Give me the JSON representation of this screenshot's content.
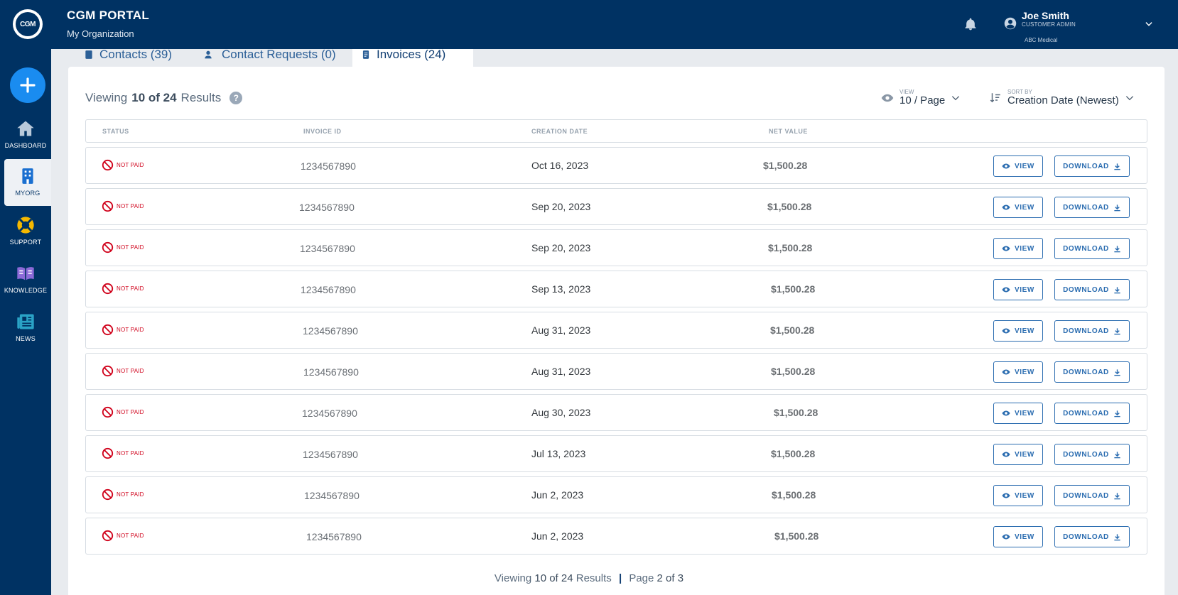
{
  "header": {
    "logo_text": "CGM",
    "title": "CGM PORTAL",
    "subtitle": "My Organization",
    "user_name": "Joe Smith",
    "user_role": "CUSTOMER ADMIN",
    "user_org": "ABC Medical"
  },
  "sidebar": {
    "items": [
      {
        "label": "DASHBOARD",
        "icon": "home-icon"
      },
      {
        "label": "MYORG",
        "icon": "building-icon",
        "active": true
      },
      {
        "label": "SUPPORT",
        "icon": "lifebuoy-icon"
      },
      {
        "label": "KNOWLEDGE",
        "icon": "book-icon"
      },
      {
        "label": "NEWS",
        "icon": "newspaper-icon"
      }
    ]
  },
  "tabs": [
    {
      "label": "Contacts (39)"
    },
    {
      "label": "Contact Requests (0)"
    },
    {
      "label": "Invoices (24)",
      "active": true
    }
  ],
  "results": {
    "prefix": "Viewing",
    "count": "10 of 24",
    "suffix": "Results"
  },
  "view_control": {
    "small_label": "VIEW",
    "value": "10 / Page"
  },
  "sort_control": {
    "small_label": "SORT BY",
    "value": "Creation Date (Newest)"
  },
  "table": {
    "columns": [
      "STATUS",
      "INVOICE ID",
      "CREATION DATE",
      "NET VALUE"
    ],
    "view_label": "VIEW",
    "download_label": "DOWNLOAD",
    "rows": [
      {
        "status": "NOT PAID",
        "id": "1234567890",
        "date": "Oct 16, 2023",
        "value": "$1,500.28"
      },
      {
        "status": "NOT PAID",
        "id": "1234567890",
        "date": "Sep 20, 2023",
        "value": "$1,500.28"
      },
      {
        "status": "NOT PAID",
        "id": "1234567890",
        "date": "Sep 20, 2023",
        "value": "$1,500.28"
      },
      {
        "status": "NOT PAID",
        "id": "1234567890",
        "date": "Sep 13, 2023",
        "value": "$1,500.28"
      },
      {
        "status": "NOT PAID",
        "id": "1234567890",
        "date": "Aug 31, 2023",
        "value": "$1,500.28"
      },
      {
        "status": "NOT PAID",
        "id": "1234567890",
        "date": "Aug 31, 2023",
        "value": "$1,500.28"
      },
      {
        "status": "NOT PAID",
        "id": "1234567890",
        "date": "Aug 30, 2023",
        "value": "$1,500.28"
      },
      {
        "status": "NOT PAID",
        "id": "1234567890",
        "date": "Jul 13, 2023",
        "value": "$1,500.28"
      },
      {
        "status": "NOT PAID",
        "id": "1234567890",
        "date": "Jun 2, 2023",
        "value": "$1,500.28"
      },
      {
        "status": "NOT PAID",
        "id": "1234567890",
        "date": "Jun 2, 2023",
        "value": "$1,500.28"
      }
    ]
  },
  "footer": {
    "prefix": "Viewing",
    "count": "10 of 24",
    "suffix": "Results",
    "page_prefix": "Page",
    "page": "2 of 3"
  },
  "colors": {
    "brand": "#003263",
    "accent": "#1a8cf0",
    "danger": "#d0021b",
    "link": "#2a6cb0"
  }
}
